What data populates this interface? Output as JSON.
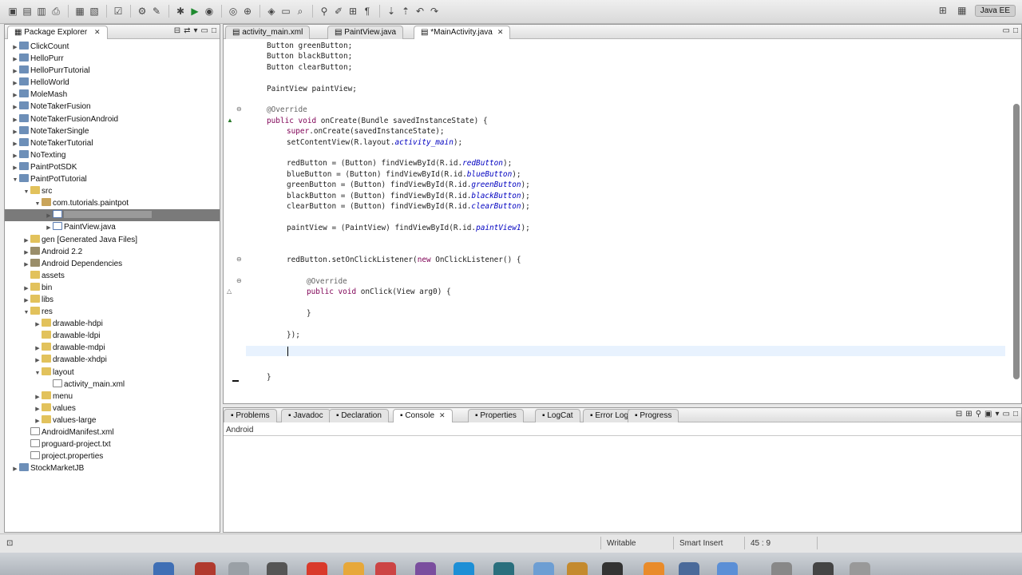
{
  "app": {
    "perspective_label": "Java EE"
  },
  "package_explorer": {
    "title": "Package Explorer",
    "items": [
      {
        "label": "ClickCount",
        "level": 0,
        "twisty": "▶",
        "icon": "project-icon"
      },
      {
        "label": "HelloPurr",
        "level": 0,
        "twisty": "▶",
        "icon": "project-icon"
      },
      {
        "label": "HelloPurrTutorial",
        "level": 0,
        "twisty": "▶",
        "icon": "project-icon"
      },
      {
        "label": "HelloWorld",
        "level": 0,
        "twisty": "▶",
        "icon": "project-icon"
      },
      {
        "label": "MoleMash",
        "level": 0,
        "twisty": "▶",
        "icon": "project-icon"
      },
      {
        "label": "NoteTakerFusion",
        "level": 0,
        "twisty": "▶",
        "icon": "project-icon"
      },
      {
        "label": "NoteTakerFusionAndroid",
        "level": 0,
        "twisty": "▶",
        "icon": "project-icon"
      },
      {
        "label": "NoteTakerSingle",
        "level": 0,
        "twisty": "▶",
        "icon": "project-icon"
      },
      {
        "label": "NoteTakerTutorial",
        "level": 0,
        "twisty": "▶",
        "icon": "project-icon"
      },
      {
        "label": "NoTexting",
        "level": 0,
        "twisty": "▶",
        "icon": "project-icon"
      },
      {
        "label": "PaintPotSDK",
        "level": 0,
        "twisty": "▶",
        "icon": "project-icon"
      },
      {
        "label": "PaintPotTutorial",
        "level": 0,
        "twisty": "▼",
        "icon": "project-icon"
      },
      {
        "label": "src",
        "level": 1,
        "twisty": "▼",
        "icon": "folder-icon"
      },
      {
        "label": "com.tutorials.paintpot",
        "level": 2,
        "twisty": "▼",
        "icon": "package-icon"
      },
      {
        "label": "",
        "level": 3,
        "twisty": "▶",
        "icon": "java-file-icon",
        "selected": true
      },
      {
        "label": "PaintView.java",
        "level": 3,
        "twisty": "▶",
        "icon": "java-file-icon"
      },
      {
        "label": "gen [Generated Java Files]",
        "level": 1,
        "twisty": "▶",
        "icon": "folder-icon"
      },
      {
        "label": "Android 2.2",
        "level": 1,
        "twisty": "▶",
        "icon": "library-icon"
      },
      {
        "label": "Android Dependencies",
        "level": 1,
        "twisty": "▶",
        "icon": "library-icon"
      },
      {
        "label": "assets",
        "level": 1,
        "twisty": "",
        "icon": "folder-icon"
      },
      {
        "label": "bin",
        "level": 1,
        "twisty": "▶",
        "icon": "folder-icon"
      },
      {
        "label": "libs",
        "level": 1,
        "twisty": "▶",
        "icon": "folder-icon"
      },
      {
        "label": "res",
        "level": 1,
        "twisty": "▼",
        "icon": "folder-icon"
      },
      {
        "label": "drawable-hdpi",
        "level": 2,
        "twisty": "▶",
        "icon": "folder-icon"
      },
      {
        "label": "drawable-ldpi",
        "level": 2,
        "twisty": "",
        "icon": "folder-icon"
      },
      {
        "label": "drawable-mdpi",
        "level": 2,
        "twisty": "▶",
        "icon": "folder-icon"
      },
      {
        "label": "drawable-xhdpi",
        "level": 2,
        "twisty": "▶",
        "icon": "folder-icon"
      },
      {
        "label": "layout",
        "level": 2,
        "twisty": "▼",
        "icon": "folder-icon"
      },
      {
        "label": "activity_main.xml",
        "level": 3,
        "twisty": "",
        "icon": "xml-file-icon"
      },
      {
        "label": "menu",
        "level": 2,
        "twisty": "▶",
        "icon": "folder-icon"
      },
      {
        "label": "values",
        "level": 2,
        "twisty": "▶",
        "icon": "folder-icon"
      },
      {
        "label": "values-large",
        "level": 2,
        "twisty": "▶",
        "icon": "folder-icon"
      },
      {
        "label": "AndroidManifest.xml",
        "level": 1,
        "twisty": "",
        "icon": "xml-file-icon"
      },
      {
        "label": "proguard-project.txt",
        "level": 1,
        "twisty": "",
        "icon": "text-file-icon"
      },
      {
        "label": "project.properties",
        "level": 1,
        "twisty": "",
        "icon": "text-file-icon"
      },
      {
        "label": "StockMarketJB",
        "level": 0,
        "twisty": "▶",
        "icon": "project-icon"
      }
    ]
  },
  "editor": {
    "tabs": [
      {
        "label": "activity_main.xml",
        "active": false
      },
      {
        "label": "PaintView.java",
        "active": false
      },
      {
        "label": "*MainActivity.java",
        "active": true
      }
    ],
    "lines": [
      {
        "row": 0,
        "indent": 0,
        "text": "Button greenButton;"
      },
      {
        "row": 1,
        "indent": 0,
        "text": "Button blackButton;"
      },
      {
        "row": 2,
        "indent": 0,
        "text": "Button clearButton;"
      },
      {
        "row": 4,
        "indent": 0,
        "text": "PaintView paintView;"
      },
      {
        "row": 6,
        "indent": 0,
        "text": "@Override"
      },
      {
        "row": 7,
        "indent": 0,
        "text": "public void onCreate(Bundle savedInstanceState) {"
      },
      {
        "row": 8,
        "indent": 1,
        "text": "super.onCreate(savedInstanceState);"
      },
      {
        "row": 9,
        "indent": 1,
        "text": "setContentView(R.layout.activity_main);"
      },
      {
        "row": 11,
        "indent": 1,
        "text": "redButton = (Button) findViewById(R.id.redButton);"
      },
      {
        "row": 12,
        "indent": 1,
        "text": "blueButton = (Button) findViewById(R.id.blueButton);"
      },
      {
        "row": 13,
        "indent": 1,
        "text": "greenButton = (Button) findViewById(R.id.greenButton);"
      },
      {
        "row": 14,
        "indent": 1,
        "text": "blackButton = (Button) findViewById(R.id.blackButton);"
      },
      {
        "row": 15,
        "indent": 1,
        "text": "clearButton = (Button) findViewById(R.id.clearButton);"
      },
      {
        "row": 17,
        "indent": 1,
        "text": "paintView = (PaintView) findViewById(R.id.paintView1);"
      },
      {
        "row": 20,
        "indent": 1,
        "text": "redButton.setOnClickListener(new OnClickListener() {"
      },
      {
        "row": 22,
        "indent": 2,
        "text": "@Override"
      },
      {
        "row": 23,
        "indent": 2,
        "text": "public void onClick(View arg0) {"
      },
      {
        "row": 25,
        "indent": 2,
        "text": "}"
      },
      {
        "row": 27,
        "indent": 1,
        "text": "});"
      },
      {
        "row": 31,
        "indent": 0,
        "text": "}"
      }
    ]
  },
  "bottom_panel": {
    "tabs": [
      {
        "label": "Problems",
        "active": false
      },
      {
        "label": "Javadoc",
        "active": false
      },
      {
        "label": "Declaration",
        "active": false
      },
      {
        "label": "Console",
        "active": true
      },
      {
        "label": "Properties",
        "active": false
      },
      {
        "label": "LogCat",
        "active": false
      },
      {
        "label": "Error Log",
        "active": false
      },
      {
        "label": "Progress",
        "active": false
      }
    ],
    "console_label": "Android"
  },
  "status_bar": {
    "writable": "Writable",
    "insert_mode": "Smart Insert",
    "position": "45 : 9"
  },
  "colors": {
    "keyword": "#7f0055",
    "field": "#0000c0",
    "annotation": "#646464",
    "current_line": "#e8f2fe"
  }
}
